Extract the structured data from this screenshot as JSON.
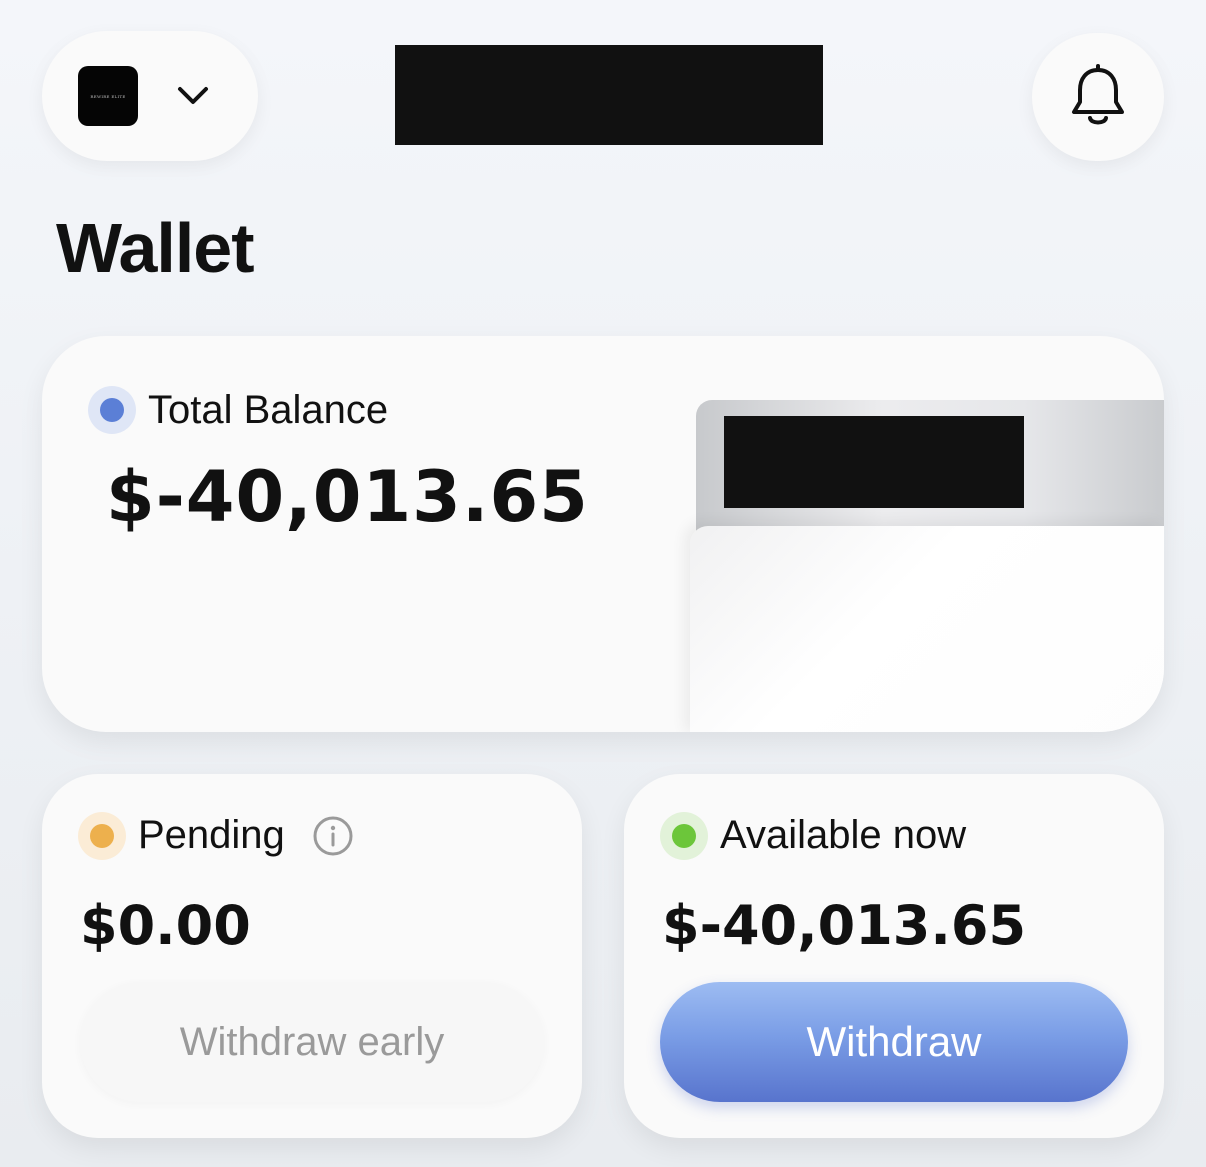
{
  "header": {
    "logo_text": "REWIRE ELITE",
    "account_switcher_icon": "chevron-down-icon",
    "notifications_icon": "bell-icon"
  },
  "page": {
    "title": "Wallet"
  },
  "total_balance": {
    "label": "Total Balance",
    "amount": "$-40,013.65",
    "dot_color": "#5b7fd6",
    "dot_halo": "#dfe6f6"
  },
  "pending": {
    "label": "Pending",
    "amount": "$0.00",
    "button_label": "Withdraw early",
    "info_icon": "info-icon",
    "dot_color": "#edb04d",
    "dot_halo": "#fbecd6"
  },
  "available": {
    "label": "Available now",
    "amount": "$-40,013.65",
    "button_label": "Withdraw",
    "dot_color": "#6cc63a",
    "dot_halo": "#e2f2d9"
  },
  "colors": {
    "accent": "#6f91e0",
    "background": "#eff2f6",
    "card": "#fafafa"
  }
}
